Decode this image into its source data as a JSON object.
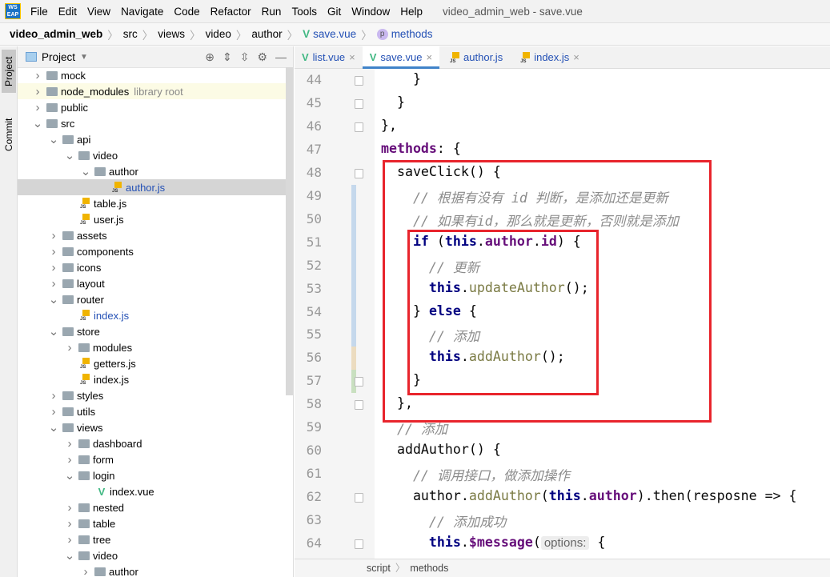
{
  "menubar": {
    "logo": "WS EAP",
    "items": [
      "File",
      "Edit",
      "View",
      "Navigate",
      "Code",
      "Refactor",
      "Run",
      "Tools",
      "Git",
      "Window",
      "Help"
    ],
    "title": "video_admin_web - save.vue"
  },
  "breadcrumb": [
    "video_admin_web",
    "src",
    "views",
    "video",
    "author",
    "save.vue",
    "methods"
  ],
  "tool_strip": {
    "project": "Project",
    "commit": "Commit"
  },
  "project_panel": {
    "title": "Project",
    "tree": [
      {
        "label": "mock",
        "level": 0,
        "type": "folder",
        "state": "collapsed"
      },
      {
        "label": "node_modules",
        "level": 0,
        "type": "folder",
        "state": "collapsed",
        "note": "library root"
      },
      {
        "label": "public",
        "level": 0,
        "type": "folder",
        "state": "collapsed"
      },
      {
        "label": "src",
        "level": 0,
        "type": "folder",
        "state": "expanded"
      },
      {
        "label": "api",
        "level": 1,
        "type": "folder",
        "state": "expanded"
      },
      {
        "label": "video",
        "level": 2,
        "type": "folder",
        "state": "expanded"
      },
      {
        "label": "author",
        "level": 3,
        "type": "folder",
        "state": "expanded"
      },
      {
        "label": "author.js",
        "level": 4,
        "type": "js",
        "selected": true
      },
      {
        "label": "table.js",
        "level": 2,
        "type": "js"
      },
      {
        "label": "user.js",
        "level": 2,
        "type": "js"
      },
      {
        "label": "assets",
        "level": 1,
        "type": "folder",
        "state": "collapsed"
      },
      {
        "label": "components",
        "level": 1,
        "type": "folder",
        "state": "collapsed"
      },
      {
        "label": "icons",
        "level": 1,
        "type": "folder",
        "state": "collapsed"
      },
      {
        "label": "layout",
        "level": 1,
        "type": "folder",
        "state": "collapsed"
      },
      {
        "label": "router",
        "level": 1,
        "type": "folder",
        "state": "expanded"
      },
      {
        "label": "index.js",
        "level": 2,
        "type": "js"
      },
      {
        "label": "store",
        "level": 1,
        "type": "folder",
        "state": "expanded"
      },
      {
        "label": "modules",
        "level": 2,
        "type": "folder",
        "state": "collapsed"
      },
      {
        "label": "getters.js",
        "level": 2,
        "type": "js"
      },
      {
        "label": "index.js",
        "level": 2,
        "type": "js"
      },
      {
        "label": "styles",
        "level": 1,
        "type": "folder",
        "state": "collapsed"
      },
      {
        "label": "utils",
        "level": 1,
        "type": "folder",
        "state": "collapsed"
      },
      {
        "label": "views",
        "level": 1,
        "type": "folder",
        "state": "expanded"
      },
      {
        "label": "dashboard",
        "level": 2,
        "type": "folder",
        "state": "collapsed"
      },
      {
        "label": "form",
        "level": 2,
        "type": "folder",
        "state": "collapsed"
      },
      {
        "label": "login",
        "level": 2,
        "type": "folder",
        "state": "expanded"
      },
      {
        "label": "index.vue",
        "level": 3,
        "type": "vue"
      },
      {
        "label": "nested",
        "level": 2,
        "type": "folder",
        "state": "collapsed"
      },
      {
        "label": "table",
        "level": 2,
        "type": "folder",
        "state": "collapsed"
      },
      {
        "label": "tree",
        "level": 2,
        "type": "folder",
        "state": "collapsed"
      },
      {
        "label": "video",
        "level": 2,
        "type": "folder",
        "state": "expanded"
      },
      {
        "label": "author",
        "level": 3,
        "type": "folder",
        "state": "collapsed"
      }
    ]
  },
  "editor": {
    "tabs": [
      {
        "label": "list.vue",
        "type": "vue"
      },
      {
        "label": "save.vue",
        "type": "vue",
        "active": true
      },
      {
        "label": "author.js",
        "type": "js"
      },
      {
        "label": "index.js",
        "type": "js"
      }
    ],
    "lines": [
      {
        "n": "44",
        "t": [
          [
            "      }",
            ""
          ]
        ]
      },
      {
        "n": "45",
        "t": [
          [
            "    }",
            ""
          ]
        ]
      },
      {
        "n": "46",
        "t": [
          [
            "  },",
            ""
          ]
        ]
      },
      {
        "n": "47",
        "t": [
          [
            "  methods",
            "pr"
          ],
          [
            ": {",
            ""
          ]
        ]
      },
      {
        "n": "48",
        "t": [
          [
            "    saveClick",
            ""
          ],
          [
            "() {",
            ""
          ]
        ]
      },
      {
        "n": "49",
        "t": [
          [
            "      // 根据有没有 id 判断，是添加还是更新",
            "cm"
          ]
        ]
      },
      {
        "n": "50",
        "t": [
          [
            "      // 如果有id，那么就是更新，否则就是添加",
            "cm"
          ]
        ]
      },
      {
        "n": "51",
        "t": [
          [
            "      if ",
            "kw"
          ],
          [
            "(",
            ""
          ],
          [
            "this",
            "kw"
          ],
          [
            ".",
            ""
          ],
          [
            "author",
            "pr"
          ],
          [
            ".",
            ""
          ],
          [
            "id",
            "pr"
          ],
          [
            ") {",
            ""
          ]
        ]
      },
      {
        "n": "52",
        "t": [
          [
            "        // 更新",
            "cm"
          ]
        ]
      },
      {
        "n": "53",
        "t": [
          [
            "        this",
            "kw"
          ],
          [
            ".",
            ""
          ],
          [
            "updateAuthor",
            "fn"
          ],
          [
            "();",
            ""
          ]
        ]
      },
      {
        "n": "54",
        "t": [
          [
            "      } ",
            ""
          ],
          [
            "else ",
            "kw"
          ],
          [
            "{",
            ""
          ]
        ]
      },
      {
        "n": "55",
        "t": [
          [
            "        // 添加",
            "cm"
          ]
        ]
      },
      {
        "n": "56",
        "t": [
          [
            "        this",
            "kw"
          ],
          [
            ".",
            ""
          ],
          [
            "addAuthor",
            "fn"
          ],
          [
            "();",
            ""
          ]
        ]
      },
      {
        "n": "57",
        "t": [
          [
            "      }",
            ""
          ]
        ]
      },
      {
        "n": "58",
        "t": [
          [
            "    },",
            ""
          ]
        ]
      },
      {
        "n": "59",
        "t": [
          [
            "    // 添加",
            "cm"
          ]
        ]
      },
      {
        "n": "60",
        "t": [
          [
            "    addAuthor",
            ""
          ],
          [
            "() {",
            ""
          ]
        ]
      },
      {
        "n": "61",
        "t": [
          [
            "      // 调用接口，做添加操作",
            "cm"
          ]
        ]
      },
      {
        "n": "62",
        "t": [
          [
            "      author.",
            ""
          ],
          [
            "addAuthor",
            "fn"
          ],
          [
            "(",
            ""
          ],
          [
            "this",
            "kw"
          ],
          [
            ".",
            ""
          ],
          [
            "author",
            "pr"
          ],
          [
            ").then(resposne => {",
            ""
          ]
        ]
      },
      {
        "n": "63",
        "t": [
          [
            "        // 添加成功",
            "cm"
          ]
        ]
      },
      {
        "n": "64",
        "t": [
          [
            "        this",
            "kw"
          ],
          [
            ".",
            ""
          ],
          [
            "$message",
            "pr"
          ],
          [
            "(",
            ""
          ],
          [
            "options:",
            "hint"
          ],
          [
            " {",
            ""
          ]
        ]
      }
    ],
    "status_breadcrumb": [
      "script",
      "methods"
    ]
  },
  "colors": {
    "highlight_box": "#e8242c",
    "vue": "#41b883",
    "keyword": "#000080",
    "property": "#660e7a"
  }
}
